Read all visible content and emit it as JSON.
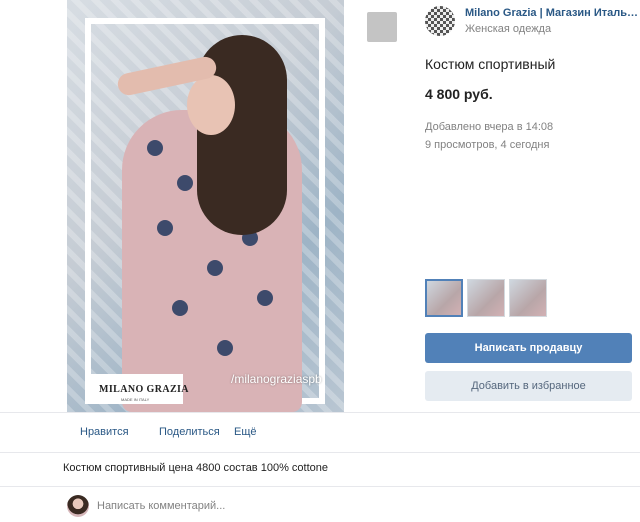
{
  "photo": {
    "brand": "MILANO GRAZIA",
    "brand_sub": "MADE IN ITALY",
    "handle": "/milanograziaspb"
  },
  "seller": {
    "name": "Milano Grazia | Магазин Итальянско...",
    "category": "Женская одежда"
  },
  "product": {
    "title": "Костюм спортивный",
    "price": "4 800 руб.",
    "added": "Добавлено вчера в 14:08",
    "views": "9 просмотров, 4 сегодня"
  },
  "buttons": {
    "message_seller": "Написать продавцу",
    "add_favorites": "Добавить в избранное"
  },
  "actions": {
    "like": "Нравится",
    "share": "Поделиться",
    "more": "Ещё"
  },
  "description": "Костюм спортивный цена 4800 состав 100% cottone",
  "comment": {
    "placeholder": "Написать комментарий..."
  },
  "colors": {
    "link": "#2a5885",
    "primary_button": "#5181b8",
    "secondary_button": "#e5ebf1",
    "muted_text": "#828282"
  }
}
